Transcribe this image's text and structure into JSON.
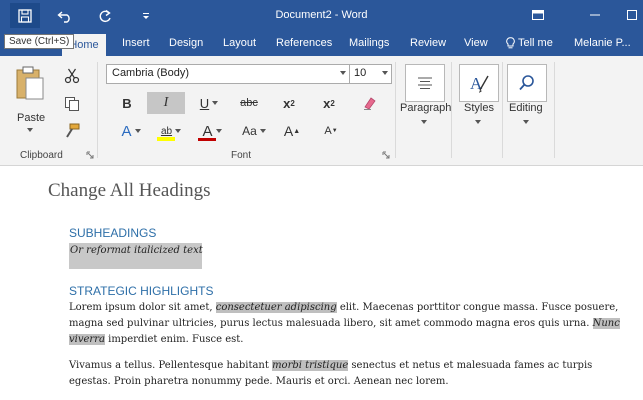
{
  "window": {
    "title": "Document2 - Word",
    "tell_me": "Tell me",
    "user": "Melanie P..."
  },
  "qat": {
    "save_tooltip": "Save (Ctrl+S)"
  },
  "tabs": [
    "Home",
    "Insert",
    "Design",
    "Layout",
    "References",
    "Mailings",
    "Review",
    "View"
  ],
  "ribbon": {
    "clipboard": {
      "paste_label": "Paste",
      "group_label": "Clipboard"
    },
    "font": {
      "font_name": "Cambria (Body)",
      "font_size": "10",
      "bold": "B",
      "italic": "I",
      "underline": "U",
      "strikethrough": "abc",
      "subscript": "x",
      "subscript_mark": "2",
      "superscript": "x",
      "superscript_mark": "2",
      "change_case": "Aa",
      "grow": "A",
      "shrink": "A",
      "text_effects": "A",
      "highlight": "ab",
      "font_color": "A",
      "group_label": "Font"
    },
    "paragraph_label": "Paragraph",
    "styles_label": "Styles",
    "editing_label": "Editing"
  },
  "colors": {
    "accent": "#2b579a",
    "heading": "#2e6fa8",
    "highlight_yellow": "#ffff00",
    "font_red": "#c00000"
  },
  "document": {
    "title": "Change All Headings",
    "subheading1": "SUBHEADINGS",
    "italic_line": "Or reformat italicized text",
    "subheading2": "STRATEGIC HIGHLIGHTS",
    "p1": {
      "l1_a": "Lorem ipsum dolor sit amet, ",
      "l1_hl": "consectetuer adipiscing",
      "l1_b": " elit. Maecenas porttitor congue massa. Fusce posuere,",
      "l2_a": "magna sed pulvinar ultricies, purus lectus malesuada libero, sit amet commodo magna eros quis urna. ",
      "l2_hl": "Nunc",
      "l3_hl": "viverra",
      "l3_b": " imperdiet enim. Fusce est."
    },
    "p2": {
      "l1_a": "Vivamus a tellus. Pellentesque habitant ",
      "l1_hl": "morbi tristique",
      "l1_b": " senectus et netus et malesuada fames ac turpis",
      "l2": "egestas. Proin pharetra nonummy pede. Mauris et orci. Aenean nec lorem."
    }
  }
}
